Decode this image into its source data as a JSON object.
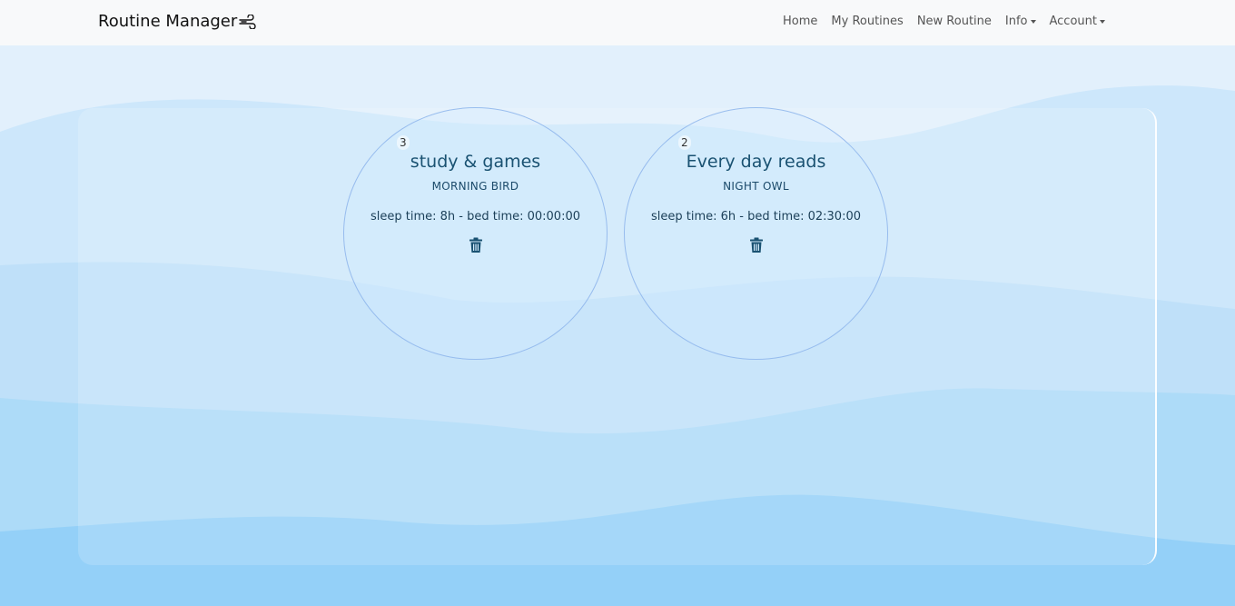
{
  "app": {
    "title": "Routine Manager"
  },
  "nav": {
    "items": [
      {
        "label": "Home"
      },
      {
        "label": "My Routines"
      },
      {
        "label": "New Routine"
      },
      {
        "label": "Info",
        "dropdown": true
      },
      {
        "label": "Account",
        "dropdown": true
      }
    ]
  },
  "routines": [
    {
      "count": "3",
      "title": "study & games",
      "type": "MORNING BIRD",
      "info": "sleep time: 8h - bed time: 00:00:00",
      "action_icon": "trash-icon"
    },
    {
      "count": "2",
      "title": "Every day reads",
      "type": "NIGHT OWL",
      "info": "sleep time: 6h - bed time: 02:30:00",
      "action_icon": "trash-icon"
    }
  ],
  "colors": {
    "accent": "#1a5272",
    "background": "#d9ecfb",
    "navbar": "#f8f9fa"
  }
}
